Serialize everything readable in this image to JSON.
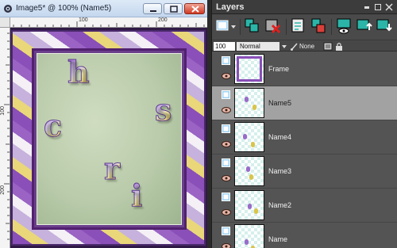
{
  "image_window": {
    "title": "Image5* @ 100% (Name5)",
    "ruler_top_labels": [
      "100",
      "200"
    ],
    "ruler_left_labels": [
      "100",
      "200"
    ],
    "canvas_letters": [
      "h",
      "s",
      "c",
      "r",
      "i"
    ],
    "colors": {
      "frame_purple": "#8a4fb8",
      "frame_gold": "#e9d77a",
      "paper": "#c4d4b4"
    }
  },
  "layers_palette": {
    "title": "Layers",
    "opacity": "100",
    "blend_mode": "Normal",
    "mask_mode": "None",
    "layers": [
      {
        "name": "Frame",
        "selected": false
      },
      {
        "name": "Name5",
        "selected": true
      },
      {
        "name": "Name4",
        "selected": false
      },
      {
        "name": "Name3",
        "selected": false
      },
      {
        "name": "Name2",
        "selected": false
      },
      {
        "name": "Name",
        "selected": false
      }
    ]
  }
}
